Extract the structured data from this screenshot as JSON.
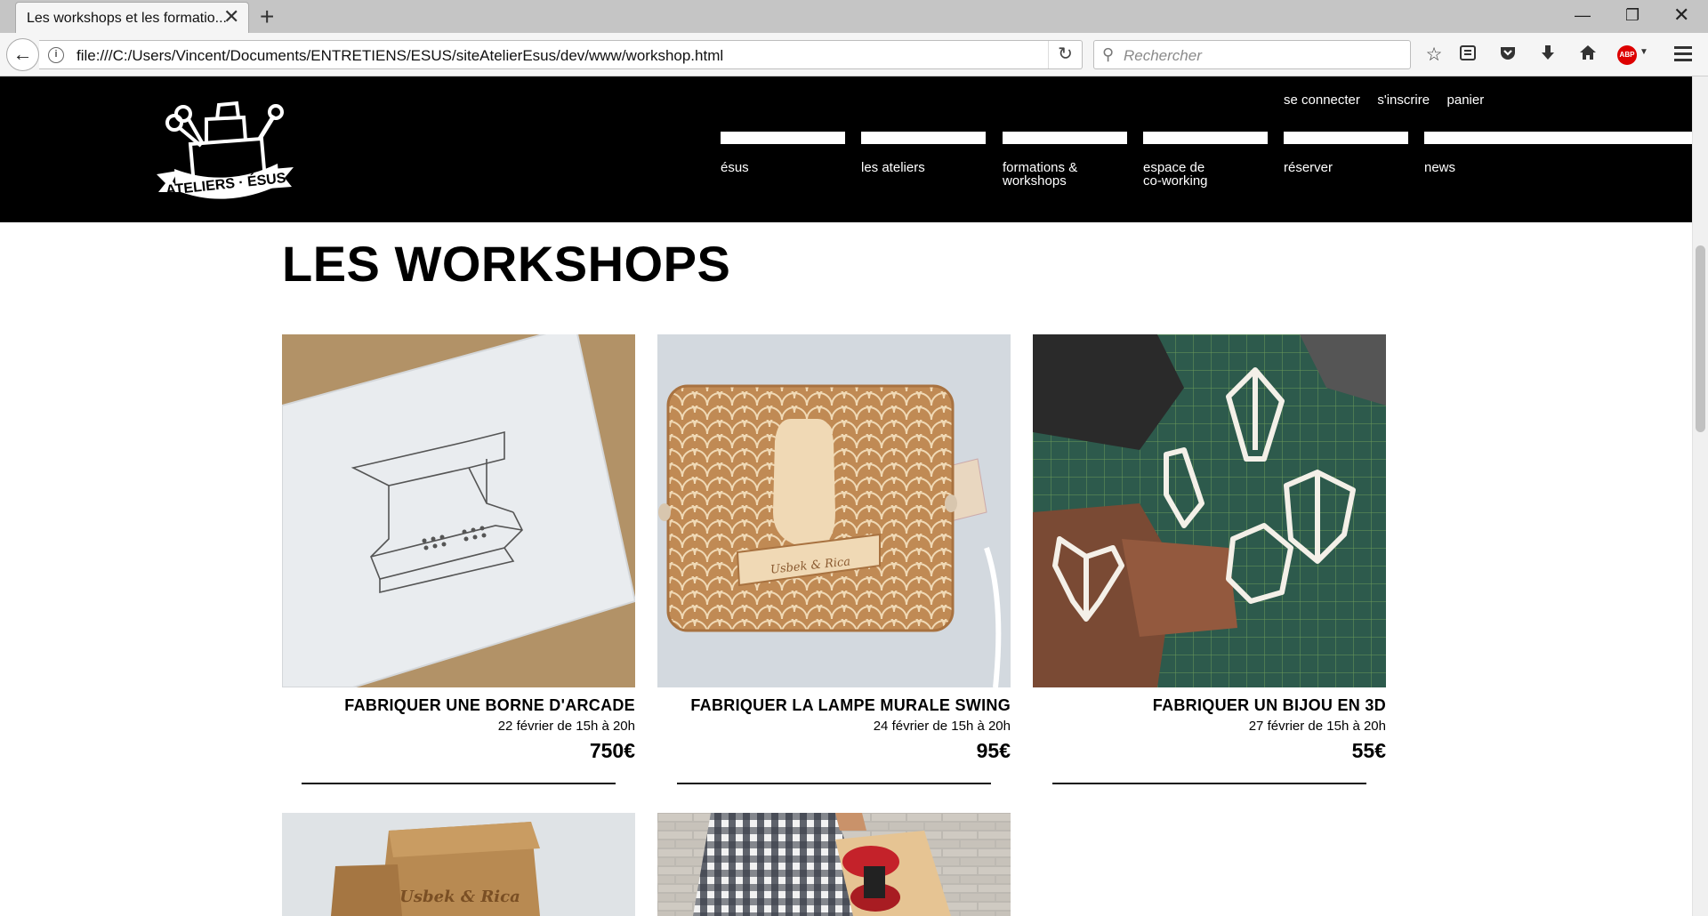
{
  "browser": {
    "tab_title": "Les workshops et les formatio...",
    "url": "file:///C:/Users/Vincent/Documents/ENTRETIENS/ESUS/siteAtelierEsus/dev/www/workshop.html",
    "search_placeholder": "Rechercher",
    "abp_label": "ABP"
  },
  "site": {
    "logo_text": "ATELIERS · ÉSUS",
    "top_links": [
      "se connecter",
      "s'inscrire",
      "panier"
    ],
    "nav": [
      {
        "line1": "ésus",
        "line2": ""
      },
      {
        "line1": "les ateliers",
        "line2": ""
      },
      {
        "line1": "formations &",
        "line2": "workshops"
      },
      {
        "line1": "espace de",
        "line2": "co-working"
      },
      {
        "line1": "réserver",
        "line2": ""
      },
      {
        "line1": "news",
        "line2": ""
      }
    ]
  },
  "main": {
    "title": "LES WORKSHOPS",
    "workshops": [
      {
        "title": "FABRIQUER UNE BORNE D'ARCADE",
        "date": "22 février de 15h à 20h",
        "price": "750€"
      },
      {
        "title": "FABRIQUER LA LAMPE MURALE SWING",
        "date": "24 février de 15h à 20h",
        "price": "95€",
        "lamp_text": "Usbek & Rica"
      },
      {
        "title": "FABRIQUER UN BIJOU EN 3D",
        "date": "27 février de 15h à 20h",
        "price": "55€"
      }
    ],
    "partial_cards": [
      {
        "image_text": "Usbek & Rica"
      },
      {
        "image_text": ""
      }
    ]
  }
}
